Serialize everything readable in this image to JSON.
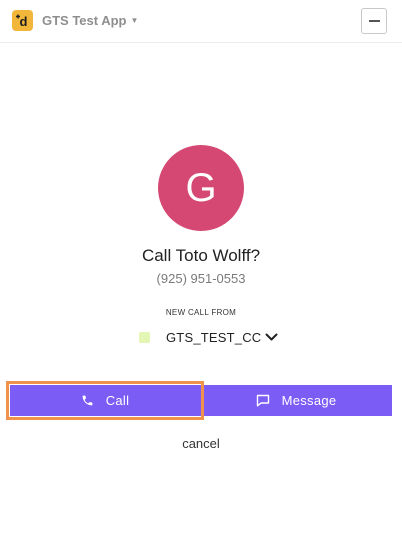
{
  "header": {
    "app_name": "GTS Test App",
    "logo_glyph": "d",
    "logo_color": "#f2b63a"
  },
  "contact": {
    "avatar_initial": "G",
    "avatar_color": "#d44873",
    "call_prompt": "Call Toto Wolff?",
    "phone": "(925) 951-0553"
  },
  "caller_id": {
    "heading": "NEW CALL FROM",
    "selected": "GTS_TEST_CC",
    "swatch_color": "#e4f6b4"
  },
  "actions": {
    "call_label": "Call",
    "message_label": "Message",
    "cancel_label": "cancel",
    "button_color": "#7b5cf5",
    "highlight_color": "#f0924c"
  },
  "icons": {
    "minimize": "minus-icon",
    "call": "phone-icon",
    "message": "chat-bubble-icon",
    "dropdown": "chevron-down-icon"
  }
}
